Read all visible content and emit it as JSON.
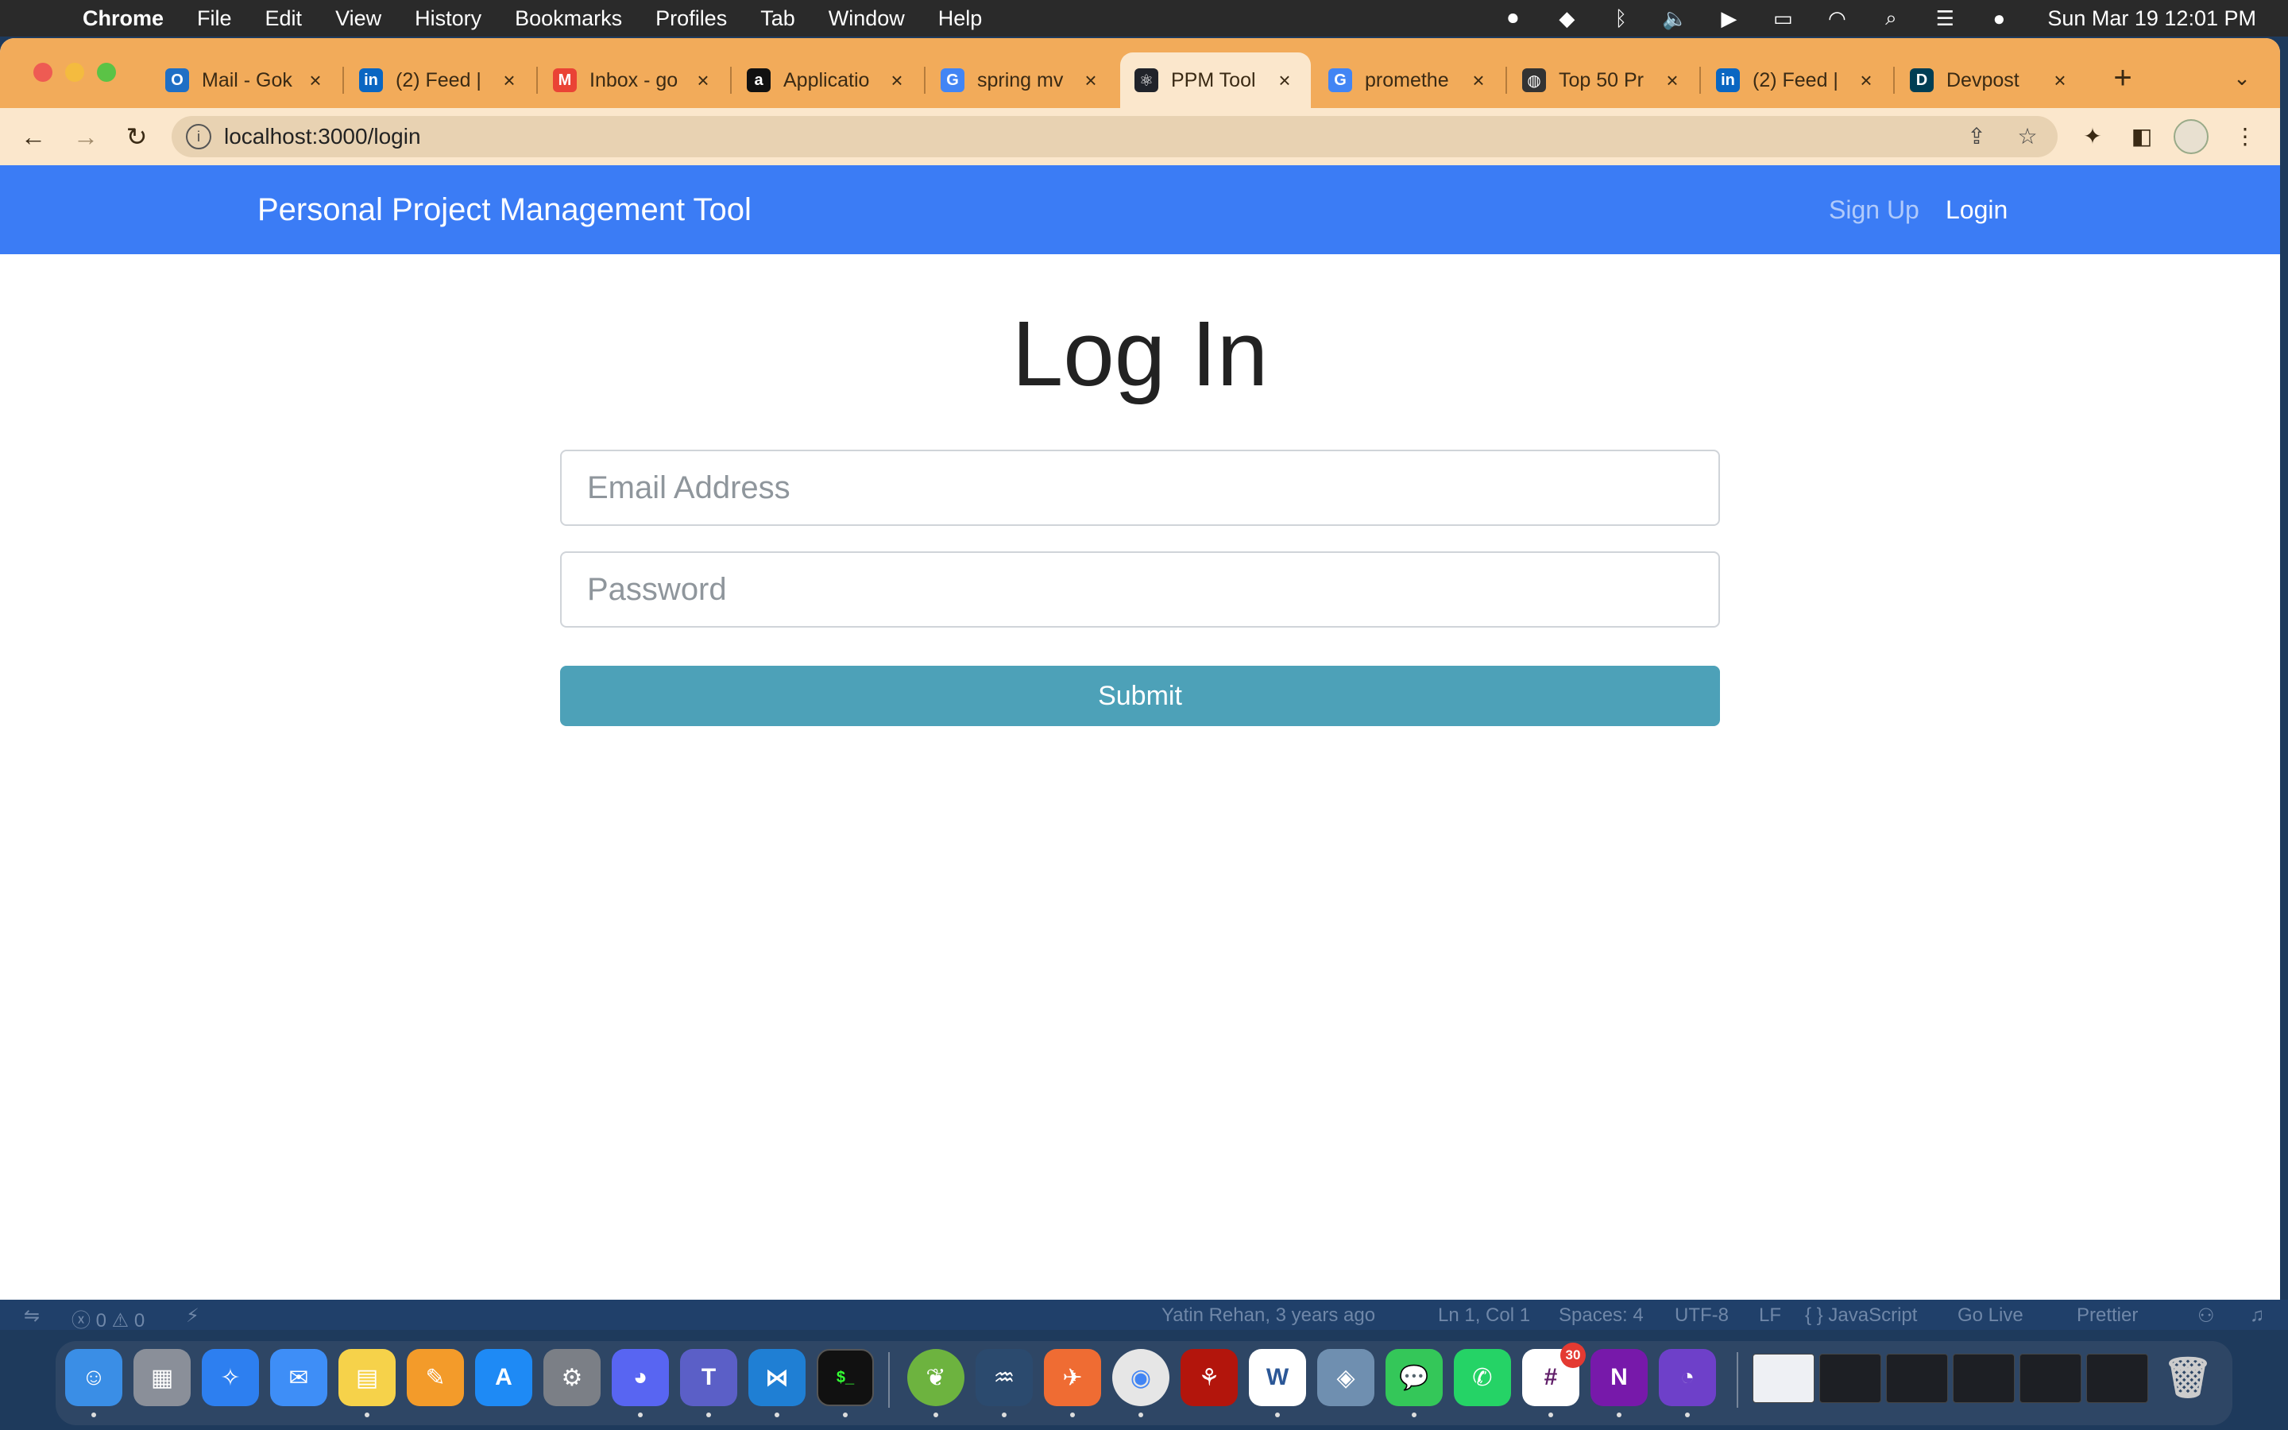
{
  "menubar": {
    "app_name": "Chrome",
    "items": [
      "File",
      "Edit",
      "View",
      "History",
      "Bookmarks",
      "Profiles",
      "Tab",
      "Window",
      "Help"
    ],
    "clock": "Sun Mar 19  12:01 PM"
  },
  "tabs": [
    {
      "title": "Mail - Gok",
      "icon": "outlook-icon",
      "color": "#1f6fc5",
      "glyph": "O"
    },
    {
      "title": "(2) Feed |",
      "icon": "linkedin-icon",
      "color": "#0a66c2",
      "glyph": "in"
    },
    {
      "title": "Inbox - go",
      "icon": "gmail-icon",
      "color": "#ea4335",
      "glyph": "M"
    },
    {
      "title": "Applicatio",
      "icon": "amazon-icon",
      "color": "#111111",
      "glyph": "a"
    },
    {
      "title": "spring mv",
      "icon": "google-icon",
      "color": "#4285f4",
      "glyph": "G"
    },
    {
      "title": "PPM Tool",
      "icon": "react-icon",
      "color": "#20232a",
      "glyph": "⚛",
      "active": true
    },
    {
      "title": "promethe",
      "icon": "google-icon",
      "color": "#4285f4",
      "glyph": "G"
    },
    {
      "title": "Top 50 Pr",
      "icon": "globe-icon",
      "color": "#333333",
      "glyph": "◍"
    },
    {
      "title": "(2) Feed |",
      "icon": "linkedin-icon",
      "color": "#0a66c2",
      "glyph": "in"
    },
    {
      "title": "Devpost",
      "icon": "devpost-icon",
      "color": "#003e54",
      "glyph": "D"
    }
  ],
  "address_bar": {
    "url": "localhost:3000/login"
  },
  "navbar": {
    "brand": "Personal Project Management Tool",
    "signup": "Sign Up",
    "login": "Login"
  },
  "form": {
    "heading": "Log In",
    "email_placeholder": "Email Address",
    "email_value": "",
    "password_placeholder": "Password",
    "password_value": "",
    "submit_label": "Submit"
  },
  "statusbar": {
    "problems": "ⓧ 0 ⚠ 0",
    "blame": "Yatin Rehan, 3 years ago",
    "position": "Ln 1, Col 1",
    "spaces": "Spaces: 4",
    "encoding": "UTF-8",
    "eol": "LF",
    "language": "{ } JavaScript",
    "golive": "Go Live",
    "prettier": "Prettier"
  },
  "dock": {
    "slack_badge": "30"
  },
  "colors": {
    "navbar_bg": "#3b7cf5",
    "submit_bg": "#4da1b8",
    "tabstrip_bg": "#f2ab5a"
  }
}
